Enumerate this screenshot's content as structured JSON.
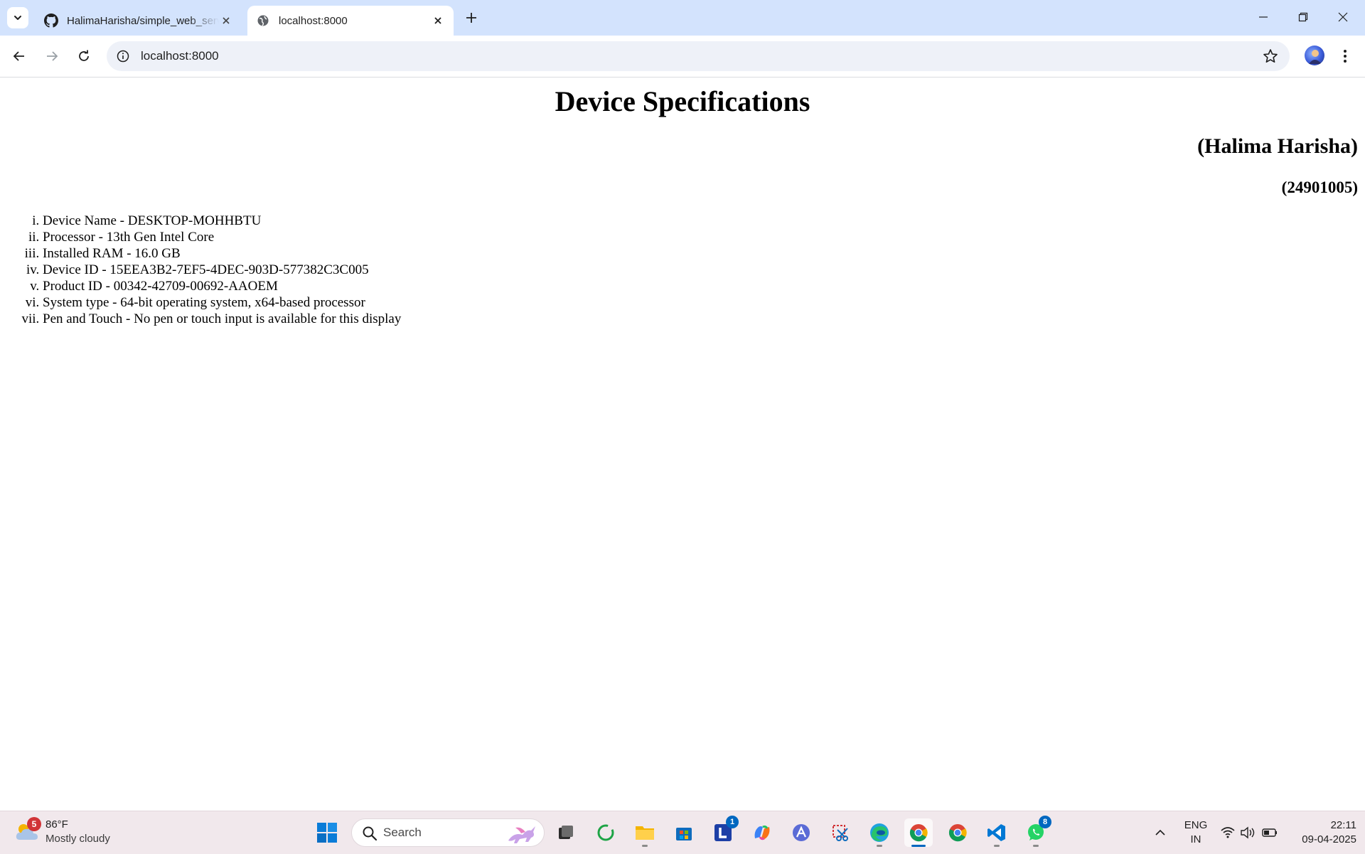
{
  "browser": {
    "tabs": [
      {
        "title": "HalimaHarisha/simple_web_server",
        "favicon": "github-icon",
        "active": false
      },
      {
        "title": "localhost:8000",
        "favicon": "globe-icon",
        "active": true
      }
    ],
    "address_bar": {
      "url": "localhost:8000"
    }
  },
  "page": {
    "title": "Device Specifications",
    "author": "(Halima Harisha)",
    "roll_number": "(24901005)",
    "specs": [
      "Device Name - DESKTOP-MOHHBTU",
      "Processor - 13th Gen Intel Core",
      "Installed RAM - 16.0 GB",
      "Device ID - 15EEA3B2-7EF5-4DEC-903D-577382C3C005",
      "Product ID - 00342-42709-00692-AAOEM",
      "System type - 64-bit operating system, x64-based processor",
      "Pen and Touch - No pen or touch input is available for this display"
    ]
  },
  "taskbar": {
    "weather": {
      "badge": "5",
      "temperature": "86°F",
      "condition": "Mostly cloudy"
    },
    "search": {
      "label": "Search"
    },
    "apps": [
      {
        "name": "task-view",
        "badge": ""
      },
      {
        "name": "refresh-app",
        "badge": ""
      },
      {
        "name": "file-explorer",
        "badge": ""
      },
      {
        "name": "microsoft-store",
        "badge": ""
      },
      {
        "name": "l-app",
        "badge": "1"
      },
      {
        "name": "copilot",
        "badge": ""
      },
      {
        "name": "arc-app",
        "badge": ""
      },
      {
        "name": "snipping-tool",
        "badge": ""
      },
      {
        "name": "edge",
        "badge": ""
      },
      {
        "name": "chrome-active",
        "badge": ""
      },
      {
        "name": "chrome",
        "badge": ""
      },
      {
        "name": "vscode",
        "badge": ""
      },
      {
        "name": "whatsapp",
        "badge": "8"
      }
    ],
    "language": {
      "line1": "ENG",
      "line2": "IN"
    },
    "clock": {
      "time": "22:11",
      "date": "09-04-2025"
    }
  },
  "colors": {
    "tabstrip_bg": "#d3e3fd",
    "omnibox_bg": "#eef1f8",
    "taskbar_bg": "#f1e8ec",
    "accent_blue": "#0067c0"
  }
}
